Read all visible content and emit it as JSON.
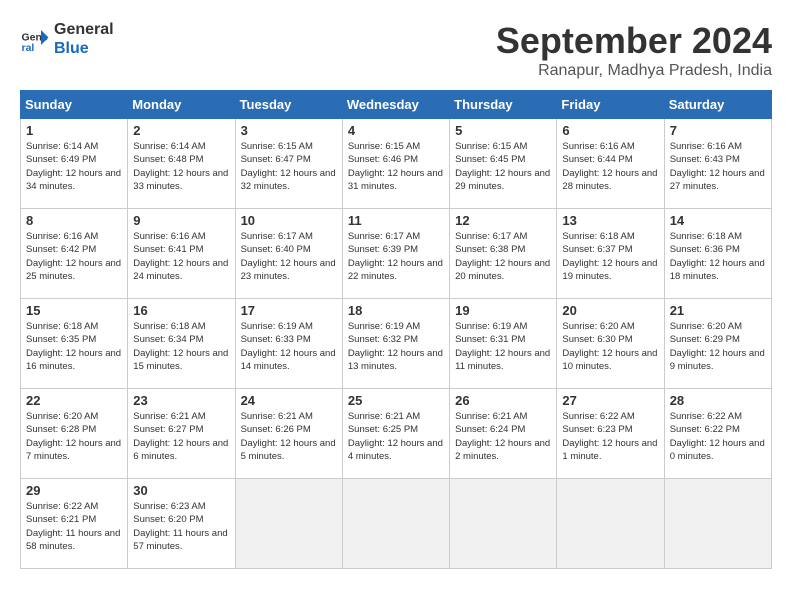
{
  "logo": {
    "line1": "General",
    "line2": "Blue"
  },
  "title": "September 2024",
  "location": "Ranapur, Madhya Pradesh, India",
  "weekdays": [
    "Sunday",
    "Monday",
    "Tuesday",
    "Wednesday",
    "Thursday",
    "Friday",
    "Saturday"
  ],
  "weeks": [
    [
      {
        "day": "1",
        "sunrise": "6:14 AM",
        "sunset": "6:49 PM",
        "daylight": "12 hours and 34 minutes."
      },
      {
        "day": "2",
        "sunrise": "6:14 AM",
        "sunset": "6:48 PM",
        "daylight": "12 hours and 33 minutes."
      },
      {
        "day": "3",
        "sunrise": "6:15 AM",
        "sunset": "6:47 PM",
        "daylight": "12 hours and 32 minutes."
      },
      {
        "day": "4",
        "sunrise": "6:15 AM",
        "sunset": "6:46 PM",
        "daylight": "12 hours and 31 minutes."
      },
      {
        "day": "5",
        "sunrise": "6:15 AM",
        "sunset": "6:45 PM",
        "daylight": "12 hours and 29 minutes."
      },
      {
        "day": "6",
        "sunrise": "6:16 AM",
        "sunset": "6:44 PM",
        "daylight": "12 hours and 28 minutes."
      },
      {
        "day": "7",
        "sunrise": "6:16 AM",
        "sunset": "6:43 PM",
        "daylight": "12 hours and 27 minutes."
      }
    ],
    [
      {
        "day": "8",
        "sunrise": "6:16 AM",
        "sunset": "6:42 PM",
        "daylight": "12 hours and 25 minutes."
      },
      {
        "day": "9",
        "sunrise": "6:16 AM",
        "sunset": "6:41 PM",
        "daylight": "12 hours and 24 minutes."
      },
      {
        "day": "10",
        "sunrise": "6:17 AM",
        "sunset": "6:40 PM",
        "daylight": "12 hours and 23 minutes."
      },
      {
        "day": "11",
        "sunrise": "6:17 AM",
        "sunset": "6:39 PM",
        "daylight": "12 hours and 22 minutes."
      },
      {
        "day": "12",
        "sunrise": "6:17 AM",
        "sunset": "6:38 PM",
        "daylight": "12 hours and 20 minutes."
      },
      {
        "day": "13",
        "sunrise": "6:18 AM",
        "sunset": "6:37 PM",
        "daylight": "12 hours and 19 minutes."
      },
      {
        "day": "14",
        "sunrise": "6:18 AM",
        "sunset": "6:36 PM",
        "daylight": "12 hours and 18 minutes."
      }
    ],
    [
      {
        "day": "15",
        "sunrise": "6:18 AM",
        "sunset": "6:35 PM",
        "daylight": "12 hours and 16 minutes."
      },
      {
        "day": "16",
        "sunrise": "6:18 AM",
        "sunset": "6:34 PM",
        "daylight": "12 hours and 15 minutes."
      },
      {
        "day": "17",
        "sunrise": "6:19 AM",
        "sunset": "6:33 PM",
        "daylight": "12 hours and 14 minutes."
      },
      {
        "day": "18",
        "sunrise": "6:19 AM",
        "sunset": "6:32 PM",
        "daylight": "12 hours and 13 minutes."
      },
      {
        "day": "19",
        "sunrise": "6:19 AM",
        "sunset": "6:31 PM",
        "daylight": "12 hours and 11 minutes."
      },
      {
        "day": "20",
        "sunrise": "6:20 AM",
        "sunset": "6:30 PM",
        "daylight": "12 hours and 10 minutes."
      },
      {
        "day": "21",
        "sunrise": "6:20 AM",
        "sunset": "6:29 PM",
        "daylight": "12 hours and 9 minutes."
      }
    ],
    [
      {
        "day": "22",
        "sunrise": "6:20 AM",
        "sunset": "6:28 PM",
        "daylight": "12 hours and 7 minutes."
      },
      {
        "day": "23",
        "sunrise": "6:21 AM",
        "sunset": "6:27 PM",
        "daylight": "12 hours and 6 minutes."
      },
      {
        "day": "24",
        "sunrise": "6:21 AM",
        "sunset": "6:26 PM",
        "daylight": "12 hours and 5 minutes."
      },
      {
        "day": "25",
        "sunrise": "6:21 AM",
        "sunset": "6:25 PM",
        "daylight": "12 hours and 4 minutes."
      },
      {
        "day": "26",
        "sunrise": "6:21 AM",
        "sunset": "6:24 PM",
        "daylight": "12 hours and 2 minutes."
      },
      {
        "day": "27",
        "sunrise": "6:22 AM",
        "sunset": "6:23 PM",
        "daylight": "12 hours and 1 minute."
      },
      {
        "day": "28",
        "sunrise": "6:22 AM",
        "sunset": "6:22 PM",
        "daylight": "12 hours and 0 minutes."
      }
    ],
    [
      {
        "day": "29",
        "sunrise": "6:22 AM",
        "sunset": "6:21 PM",
        "daylight": "11 hours and 58 minutes."
      },
      {
        "day": "30",
        "sunrise": "6:23 AM",
        "sunset": "6:20 PM",
        "daylight": "11 hours and 57 minutes."
      },
      null,
      null,
      null,
      null,
      null
    ]
  ]
}
